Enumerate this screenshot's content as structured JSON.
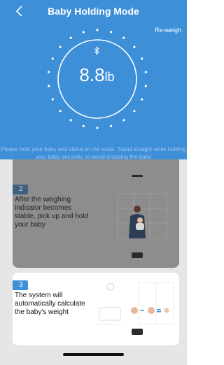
{
  "header": {
    "title": "Baby Holding Mode",
    "reweigh_label": "Re-weigh",
    "icons": {
      "back": "chevron-left-icon",
      "bluetooth": "bluetooth-icon"
    }
  },
  "reading": {
    "weight_value": "8.8",
    "weight_unit": "lb"
  },
  "instruction": "Please hold your baby and stand on the scale. Stand straight while holding your baby securely, to avoid dropping the baby",
  "steps": [
    {
      "number": "2",
      "text": "After the weighing indicator becomes stable, pick up and hold your baby"
    },
    {
      "number": "3",
      "text": "The system will automatically calculate the baby's weight"
    }
  ],
  "colors": {
    "header_bg": "#3d8fd8",
    "dimmed_card": "#8d8d8d",
    "sheet_bg": "#e6e6e6"
  }
}
